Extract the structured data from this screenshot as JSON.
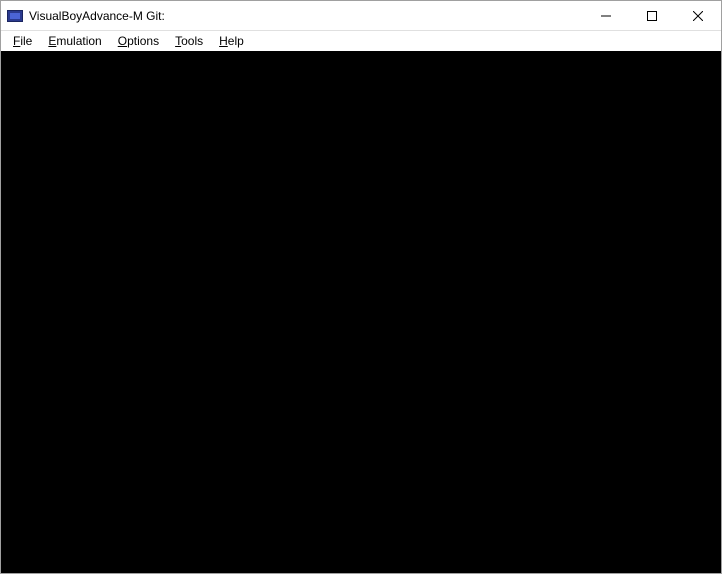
{
  "window": {
    "title": "VisualBoyAdvance-M Git:"
  },
  "menu": {
    "file": "File",
    "emulation": "Emulation",
    "options": "Options",
    "tools": "Tools",
    "help": "Help"
  }
}
